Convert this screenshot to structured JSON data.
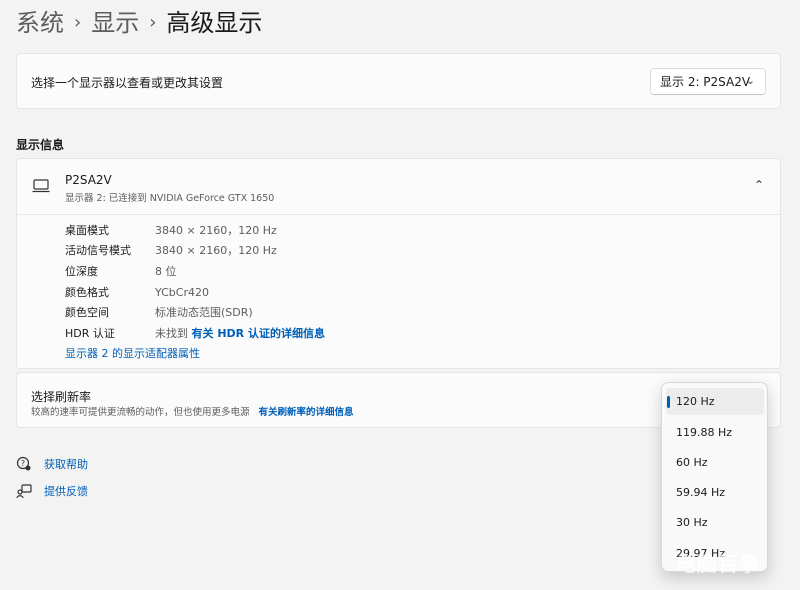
{
  "breadcrumb": {
    "items": [
      "系统",
      "显示",
      "高级显示"
    ],
    "separator": "›"
  },
  "display_select": {
    "label": "选择一个显示器以查看或更改其设置",
    "selected": "显示 2: P2SA2V"
  },
  "display_info": {
    "section_title": "显示信息",
    "monitor_name": "P2SA2V",
    "monitor_desc": "显示器 2: 已连接到 NVIDIA GeForce GTX 1650",
    "rows": [
      {
        "key": "桌面模式",
        "value": "3840 × 2160，120 Hz"
      },
      {
        "key": "活动信号模式",
        "value": "3840 × 2160，120 Hz"
      },
      {
        "key": "位深度",
        "value": "8 位"
      },
      {
        "key": "颜色格式",
        "value": "YCbCr420"
      },
      {
        "key": "颜色空间",
        "value": "标准动态范围(SDR)"
      }
    ],
    "hdr_key": "HDR 认证",
    "hdr_value": "未找到",
    "hdr_link": "有关 HDR 认证的详细信息",
    "adapter_link": "显示器 2 的显示适配器属性"
  },
  "refresh": {
    "title": "选择刷新率",
    "desc": "较高的速率可提供更流畅的动作，但也使用更多电源",
    "link": "有关刷新率的详细信息",
    "options": [
      "120 Hz",
      "119.88 Hz",
      "60 Hz",
      "59.94 Hz",
      "30 Hz",
      "29.97 Hz"
    ],
    "selected_index": 0
  },
  "help": {
    "get_help": "获取帮助",
    "feedback": "提供反馈"
  },
  "watermark": "电脑百事",
  "colors": {
    "accent": "#005fb8",
    "background": "#f3f3f3",
    "card": "#fbfbfb"
  }
}
